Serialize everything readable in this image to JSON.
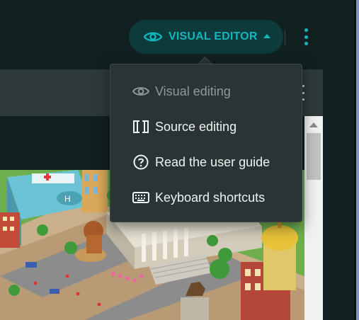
{
  "topbar": {
    "visual_editor_label": "VISUAL EDITOR",
    "icons": {
      "eye": "eye-icon",
      "caret": "caret-up-icon",
      "more": "more-vertical-icon"
    },
    "accent_color": "#14b6bd",
    "button_bg": "#0d3a3a"
  },
  "dropdown": {
    "items": [
      {
        "label": "Visual editing",
        "icon": "eye-icon",
        "disabled": true
      },
      {
        "label": "Source editing",
        "icon": "wiki-brackets-icon",
        "disabled": false
      },
      {
        "label": "Read the user guide",
        "icon": "help-circle-icon",
        "disabled": false
      },
      {
        "label": "Keyboard shortcuts",
        "icon": "keyboard-icon",
        "disabled": false
      }
    ]
  },
  "content": {
    "image": {
      "kind": "isometric-city-illustration"
    }
  },
  "colors": {
    "page_bg": "#112021",
    "menu_bg": "#2b3434",
    "menu_text": "#eef2f2",
    "menu_text_disabled": "#8f9999"
  }
}
